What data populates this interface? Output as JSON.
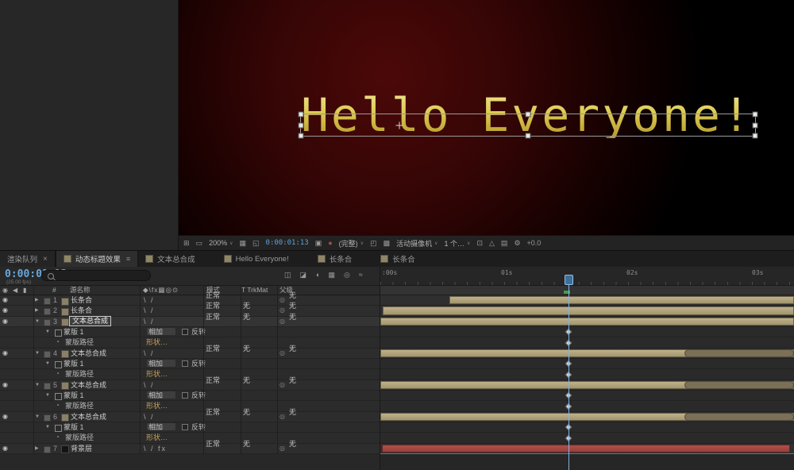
{
  "viewer": {
    "headline": "Hello Everyone!",
    "toolbar": [
      {
        "type": "icon",
        "name": "snap-view-icon",
        "icon": "⊞"
      },
      {
        "type": "icon",
        "name": "screen-mode-icon",
        "icon": "▭"
      },
      {
        "type": "dropdown",
        "name": "magnification-select",
        "label": "200%"
      },
      {
        "type": "icon",
        "name": "grid-guides-icon",
        "icon": "▦"
      },
      {
        "type": "icon",
        "name": "mask-visibility-icon",
        "icon": "◱"
      },
      {
        "type": "time",
        "name": "preview-timecode",
        "label": "0:00:01:13"
      },
      {
        "type": "icon",
        "name": "snapshot-icon",
        "icon": "▣"
      },
      {
        "type": "icon",
        "name": "show-channel-icon",
        "icon": "●",
        "color": "#96564e"
      },
      {
        "type": "dropdown",
        "name": "resolution-select",
        "label": "(完整)"
      },
      {
        "type": "icon",
        "name": "region-of-interest-icon",
        "icon": "◰"
      },
      {
        "type": "icon",
        "name": "transparency-grid-icon",
        "icon": "▩"
      },
      {
        "type": "dropdown",
        "name": "view-select",
        "label": "活动摄像机"
      },
      {
        "type": "dropdown",
        "name": "view-layout-select",
        "label": "1 个…"
      },
      {
        "type": "icon",
        "name": "pixel-aspect-icon",
        "icon": "⊡"
      },
      {
        "type": "icon",
        "name": "fast-previews-icon",
        "icon": "△"
      },
      {
        "type": "icon",
        "name": "timeline-button-icon",
        "icon": "▤"
      },
      {
        "type": "icon",
        "name": "exposure-gear-icon",
        "icon": "⚙"
      },
      {
        "type": "label",
        "name": "exposure-value",
        "label": "+0.0"
      }
    ]
  },
  "tabs": [
    {
      "name": "tab-render-queue",
      "kind": "panel",
      "label": "渲染队列",
      "close": true,
      "active": false
    },
    {
      "name": "tab-comp-title-effect",
      "kind": "comp",
      "label": "动态标题效果",
      "active": true,
      "menu": true
    },
    {
      "name": "tab-comp-text-main",
      "kind": "comp",
      "label": "文本总合成",
      "active": false
    },
    {
      "name": "tab-comp-hello",
      "kind": "comp",
      "label": "Hello Everyone!",
      "active": false
    },
    {
      "name": "tab-comp-bar-1",
      "kind": "comp",
      "label": "长条合",
      "active": false
    },
    {
      "name": "tab-comp-bar-2",
      "kind": "comp",
      "label": "长条合",
      "active": false
    }
  ],
  "timeline": {
    "timecode": "0:00:01:13",
    "fps": "(25.00 fps)",
    "panel_icons": [
      {
        "name": "comp-mini-flowchart-icon",
        "icon": "◫"
      },
      {
        "name": "draft-3d-icon",
        "icon": "◪"
      },
      {
        "name": "hide-shy-icon",
        "icon": "◖"
      },
      {
        "name": "frame-blend-icon",
        "icon": "▦"
      },
      {
        "name": "motion-blur-icon",
        "icon": "◎"
      },
      {
        "name": "graph-editor-icon",
        "icon": "≈"
      }
    ],
    "av_icons": [
      {
        "name": "video-column-icon",
        "icon": "◉"
      },
      {
        "name": "audio-column-icon",
        "icon": "◀"
      },
      {
        "name": "lock-column-icon",
        "icon": "▮"
      }
    ],
    "headers": {
      "number": "#",
      "source": "源名称",
      "switches": "◆\\fx▦◎⊙",
      "mode": "模式",
      "trkmat": "T TrkMat",
      "parent": "父级"
    },
    "ruler_labels": [
      ":00s",
      "01s",
      "02s",
      "03s"
    ],
    "rows": [
      {
        "kind": "layer",
        "num": "1",
        "name": "长条合",
        "icon": "comp",
        "switches": "\\ /",
        "mode": "正常",
        "trkmat": "",
        "parent": "无",
        "expanded": false,
        "bar": {
          "start": 16.7,
          "end": 100,
          "color": "tan"
        }
      },
      {
        "kind": "layer",
        "num": "2",
        "name": "长条合",
        "icon": "comp",
        "switches": "\\ /",
        "mode": "正常",
        "trkmat": "无",
        "parent": "无",
        "expanded": false,
        "bar": {
          "start": 0.6,
          "end": 100,
          "color": "tan"
        }
      },
      {
        "kind": "layer",
        "num": "3",
        "name": "文本总合成",
        "icon": "comp",
        "switches": "\\ /",
        "mode": "正常",
        "trkmat": "无",
        "parent": "无",
        "expanded": true,
        "selected": true,
        "bar": {
          "start": 0,
          "end": 100,
          "color": "tan"
        }
      },
      {
        "kind": "mask",
        "name": "蒙版 1",
        "mode": "相加",
        "inverted": "反转",
        "marker": true
      },
      {
        "kind": "maskprop",
        "name": "蒙版路径",
        "value": "形状…",
        "marker": true
      },
      {
        "kind": "layer",
        "num": "4",
        "name": "文本总合成",
        "icon": "comp",
        "switches": "\\ /",
        "mode": "正常",
        "trkmat": "无",
        "parent": "无",
        "expanded": true,
        "bar": {
          "start": 0,
          "end": 100,
          "color": "tan",
          "cap": [
            73.6,
            100
          ]
        }
      },
      {
        "kind": "mask",
        "name": "蒙版 1",
        "mode": "相加",
        "inverted": "反转",
        "marker": true
      },
      {
        "kind": "maskprop",
        "name": "蒙版路径",
        "value": "形状…",
        "marker": true
      },
      {
        "kind": "layer",
        "num": "5",
        "name": "文本总合成",
        "icon": "comp",
        "switches": "\\ /",
        "mode": "正常",
        "trkmat": "无",
        "parent": "无",
        "expanded": true,
        "bar": {
          "start": 0,
          "end": 100,
          "color": "tan",
          "cap": [
            73.6,
            100
          ]
        }
      },
      {
        "kind": "mask",
        "name": "蒙版 1",
        "mode": "相加",
        "inverted": "反转",
        "marker": true
      },
      {
        "kind": "maskprop",
        "name": "蒙版路径",
        "value": "形状…",
        "marker": true
      },
      {
        "kind": "layer",
        "num": "6",
        "name": "文本总合成",
        "icon": "comp",
        "switches": "\\ /",
        "mode": "正常",
        "trkmat": "无",
        "parent": "无",
        "expanded": true,
        "bar": {
          "start": 0,
          "end": 100,
          "color": "tan",
          "cap": [
            73.6,
            100
          ]
        }
      },
      {
        "kind": "mask",
        "name": "蒙版 1",
        "mode": "相加",
        "inverted": "反转",
        "marker": true
      },
      {
        "kind": "maskprop",
        "name": "蒙版路径",
        "value": "形状…",
        "marker": true
      },
      {
        "kind": "layer",
        "num": "7",
        "name": "背景层",
        "icon": "solid",
        "switches": "\\ / fx",
        "mode": "正常",
        "trkmat": "无",
        "parent": "无",
        "expanded": false,
        "bar": {
          "start": 0.4,
          "end": 99,
          "color": "red"
        }
      }
    ]
  },
  "glyphs": {
    "caret": "∨",
    "collapsed": "▶",
    "expanded": "▼",
    "eye": "◉",
    "pickwhip": "◎",
    "stopwatch": "◔",
    "menu": "≡",
    "close": "×"
  }
}
